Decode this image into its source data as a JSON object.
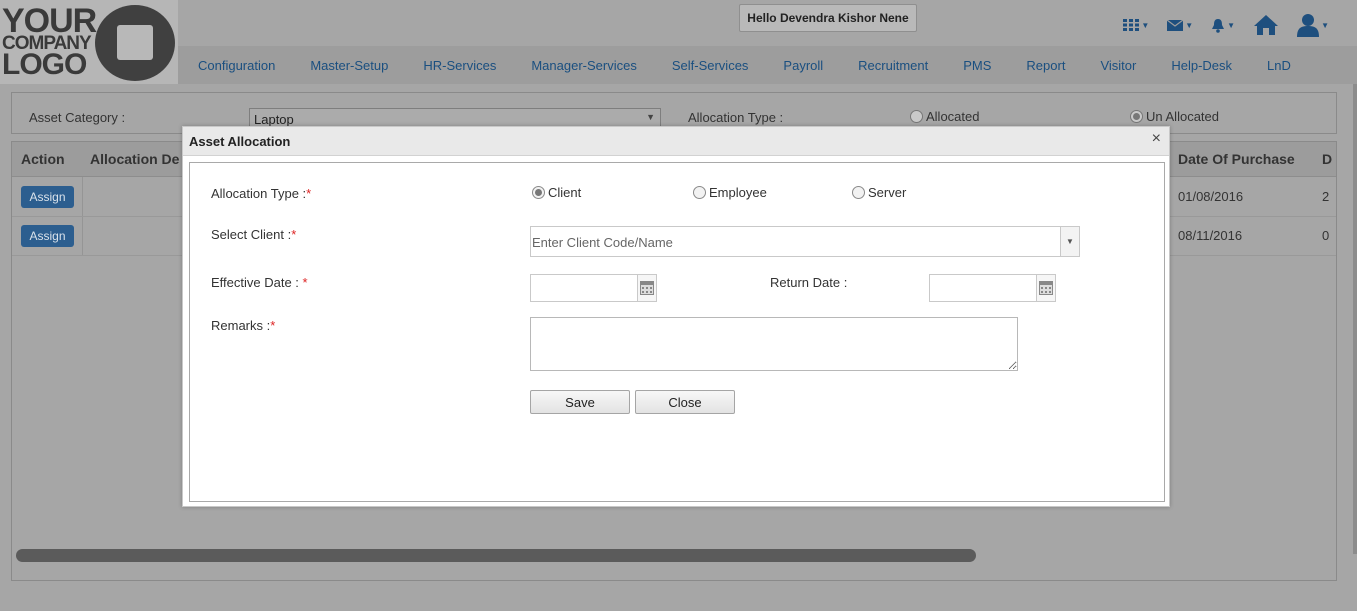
{
  "logo": {
    "line1": "YOUR",
    "line2": "COMPANY",
    "line3": "LOGO"
  },
  "header": {
    "greeting": "Hello Devendra Kishor Nene",
    "icons": [
      "grid-icon",
      "mail-icon",
      "bell-icon",
      "home-icon",
      "user-icon"
    ]
  },
  "nav": {
    "items": [
      "Configuration",
      "Master-Setup",
      "HR-Services",
      "Manager-Services",
      "Self-Services",
      "Payroll",
      "Recruitment",
      "PMS",
      "Report",
      "Visitor",
      "Help-Desk",
      "LnD"
    ]
  },
  "filter": {
    "asset_category_label": "Asset Category :",
    "asset_category_value": "Laptop",
    "allocation_type_label": "Allocation Type :",
    "allocated_label": "Allocated",
    "unallocated_label": "Un Allocated",
    "selected": "Un Allocated"
  },
  "grid": {
    "columns": [
      "Action",
      "Allocation De",
      "Date Of Purchase",
      "D"
    ],
    "rows": [
      {
        "action": "Assign",
        "date_of_purchase": "01/08/2016",
        "next": "2"
      },
      {
        "action": "Assign",
        "date_of_purchase": "08/11/2016",
        "next": "0"
      }
    ]
  },
  "modal": {
    "title": "Asset Allocation",
    "close_glyph": "×",
    "allocation_type_label": "Allocation Type :",
    "options": [
      "Client",
      "Employee",
      "Server"
    ],
    "selected_option": "Client",
    "select_client_label": "Select Client :",
    "client_placeholder": "Enter Client Code/Name",
    "effective_date_label": "Effective Date : ",
    "effective_date_value": "",
    "return_date_label": "Return Date :",
    "return_date_value": "",
    "remarks_label": "Remarks :",
    "remarks_value": "",
    "required_mark": "*",
    "save_label": "Save",
    "close_label": "Close"
  },
  "colors": {
    "overlay": "#a6a6a6",
    "nav_link": "#1a4f80",
    "assign_button": "#2c5e8f",
    "required": "#dd2222"
  }
}
